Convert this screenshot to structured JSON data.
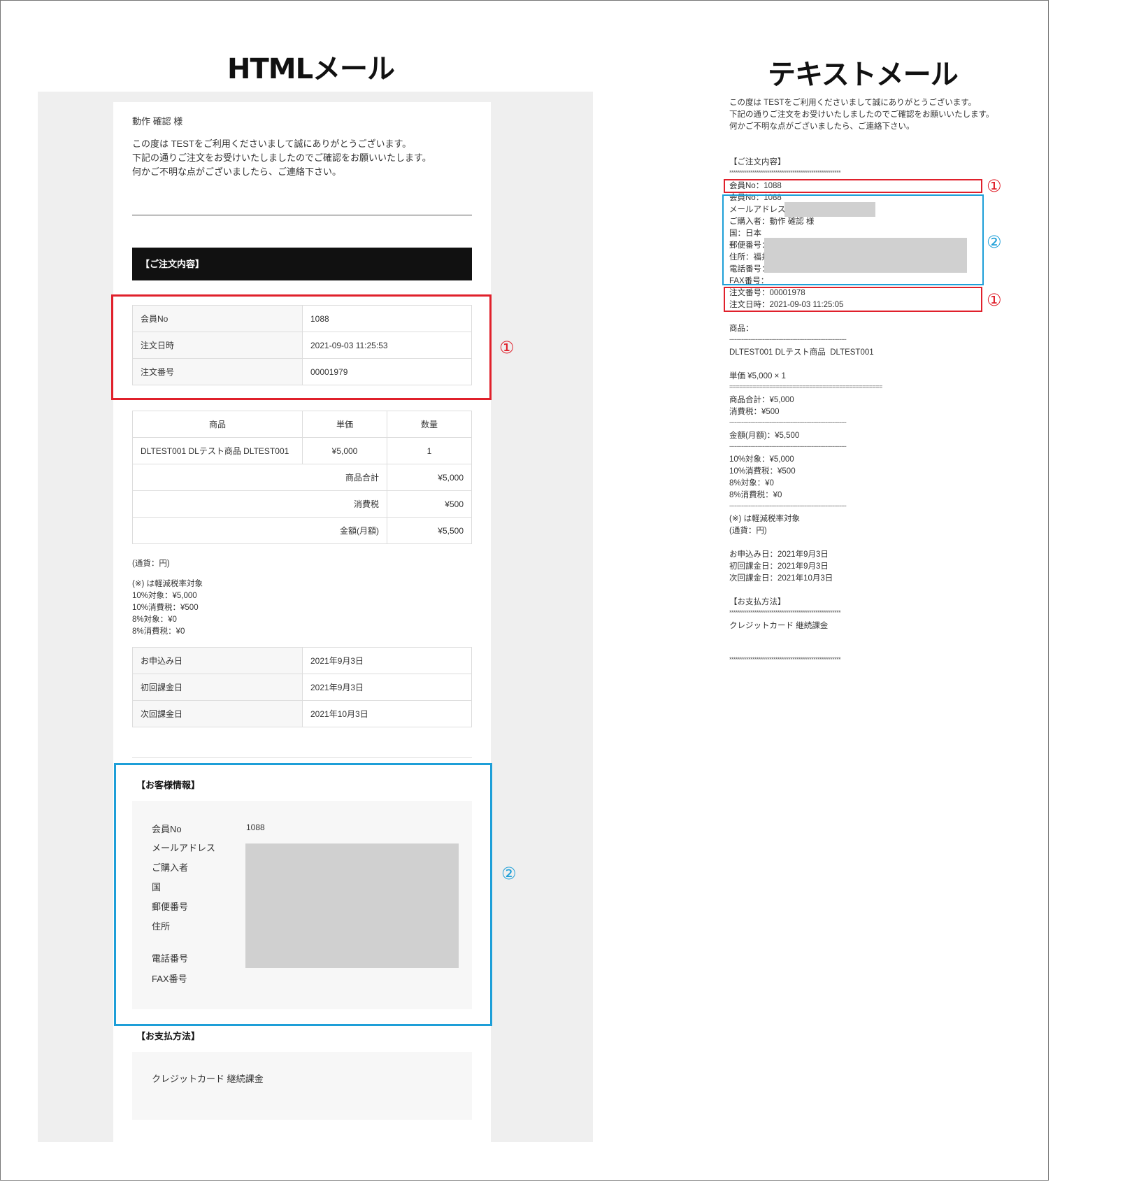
{
  "headings": {
    "html_mail": "HTMLメール",
    "text_mail": "テキストメール"
  },
  "html_mail": {
    "greeting": "動作 確認 様",
    "intro": [
      "この度は TESTをご利用くださいまして誠にありがとうございます。",
      "下記の通りご注文をお受けいたしましたのでご確認をお願いいたします。",
      "何かご不明な点がございましたら、ご連絡下さい。"
    ],
    "order_section_title": "【ご注文内容】",
    "order_info": [
      {
        "label": "会員No",
        "value": "1088"
      },
      {
        "label": "注文日時",
        "value": "2021-09-03 11:25:53"
      },
      {
        "label": "注文番号",
        "value": "00001979"
      }
    ],
    "items_header": {
      "product": "商品",
      "unit_price": "単価",
      "qty": "数量"
    },
    "items": [
      {
        "product": "DLTEST001 DLテスト商品 DLTEST001",
        "unit_price": "¥5,000",
        "qty": "1"
      }
    ],
    "totals": [
      {
        "label": "商品合計",
        "value": "¥5,000"
      },
      {
        "label": "消費税",
        "value": "¥500"
      },
      {
        "label": "金額(月額)",
        "value": "¥5,500"
      }
    ],
    "currency_note": "(通貨：円)",
    "tax_notes": [
      "(※) は軽減税率対象",
      "10%対象：¥5,000",
      "10%消費税：¥500",
      "8%対象：¥0",
      "8%消費税：¥0"
    ],
    "dates": [
      {
        "label": "お申込み日",
        "value": "2021年9月3日"
      },
      {
        "label": "初回課金日",
        "value": "2021年9月3日"
      },
      {
        "label": "次回課金日",
        "value": "2021年10月3日"
      }
    ],
    "customer_section_title": "【お客様情報】",
    "customer_labels": [
      "会員No",
      "メールアドレス",
      "ご購入者",
      "国",
      "郵便番号",
      "住所",
      "電話番号",
      "FAX番号"
    ],
    "customer_member_no": "1088",
    "payment_section_title": "【お支払方法】",
    "payment_method": "クレジットカード 継続課金"
  },
  "text_mail": {
    "intro": [
      "この度は TESTをご利用くださいまして誠にありがとうございます。",
      "下記の通りご注文をお受けいたしましたのでご確認をお願いいたします。",
      "何かご不明な点がございましたら、ご連絡下さい。"
    ],
    "order_title": "【ご注文内容】",
    "stars": "*****************************************************",
    "dashes": "-------------------------------------------------------------------",
    "equals": "==============================================",
    "member_no_1": "会員No：1088",
    "member_no_2": "会員No：1088",
    "email": "メールアドレス：",
    "buyer": "ご購入者：動作 確認 様",
    "country": "国：日本",
    "postal": "郵便番号：",
    "address": "住所：福井",
    "phone": "電話番号：",
    "fax": "FAX番号：",
    "order_no": "注文番号：00001978",
    "order_date": "注文日時：2021-09-03 11:25:05",
    "product_label": "商品：",
    "product_line": "DLTEST001 DLテスト商品  DLTEST001",
    "unit_line": "単価 ¥5,000 × 1",
    "subtotal": "商品合計：¥5,000",
    "tax": "消費税：¥500",
    "amount": "金額(月額)：¥5,500",
    "tax10_target": "10%対象：¥5,000",
    "tax10": "10%消費税：¥500",
    "tax8_target": "8%対象：¥0",
    "tax8": "8%消費税：¥0",
    "reduced_note": "(※) は軽減税率対象",
    "currency": "(通貨：円)",
    "apply_date": "お申込み日：2021年9月3日",
    "first_charge": "初回課金日：2021年9月3日",
    "next_charge": "次回課金日：2021年10月3日",
    "payment_title": "【お支払方法】",
    "payment_method": "クレジットカード 継続課金"
  },
  "markers": {
    "one": "①",
    "two": "②"
  },
  "colors": {
    "red": "#e0202b",
    "blue": "#1e9fd8",
    "black_bar": "#111111",
    "redacted": "#d0d0d0"
  }
}
